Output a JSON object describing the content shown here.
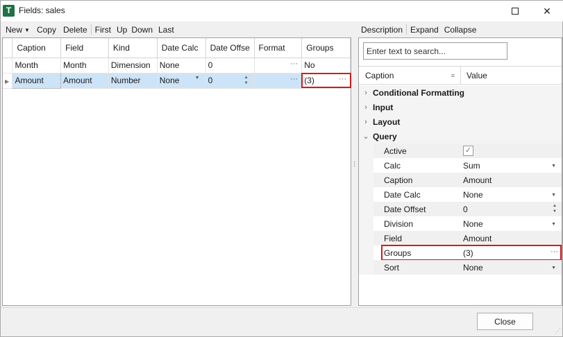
{
  "window": {
    "icon_letter": "T",
    "title": "Fields: sales",
    "minimize": "—",
    "close": "✕"
  },
  "left_toolbar": {
    "new": "New",
    "copy": "Copy",
    "delete": "Delete",
    "first": "First",
    "up": "Up",
    "down": "Down",
    "last": "Last"
  },
  "right_toolbar": {
    "description": "Description",
    "expand": "Expand",
    "collapse": "Collapse"
  },
  "grid": {
    "columns": [
      "Caption",
      "Field",
      "Kind",
      "Date Calc",
      "Date Offse",
      "Format",
      "Groups"
    ],
    "rows": [
      {
        "caption": "Month",
        "field": "Month",
        "kind": "Dimension",
        "date_calc": "None",
        "date_offset": "0",
        "format": "",
        "groups": "No"
      },
      {
        "caption": "Amount",
        "field": "Amount",
        "kind": "Number",
        "date_calc": "None",
        "date_offset": "0",
        "format": "",
        "groups": "(3)"
      }
    ],
    "selected_row": 1
  },
  "inspector": {
    "search_placeholder": "Enter text to search...",
    "header_caption": "Caption",
    "header_value": "Value",
    "categories": {
      "conditional_formatting": "Conditional Formatting",
      "input": "Input",
      "layout": "Layout",
      "query": "Query"
    },
    "query_props": {
      "active": {
        "name": "Active",
        "checked": true
      },
      "calc": {
        "name": "Calc",
        "value": "Sum"
      },
      "caption": {
        "name": "Caption",
        "value": "Amount"
      },
      "date_calc": {
        "name": "Date Calc",
        "value": "None"
      },
      "date_offset": {
        "name": "Date Offset",
        "value": "0"
      },
      "division": {
        "name": "Division",
        "value": "None"
      },
      "field": {
        "name": "Field",
        "value": "Amount"
      },
      "groups": {
        "name": "Groups",
        "value": "(3)"
      },
      "sort": {
        "name": "Sort",
        "value": "None"
      }
    }
  },
  "footer": {
    "close_label": "Close"
  },
  "colors": {
    "selection": "#cde3f7",
    "highlight": "#d11a1a",
    "app_icon": "#1e7145"
  }
}
